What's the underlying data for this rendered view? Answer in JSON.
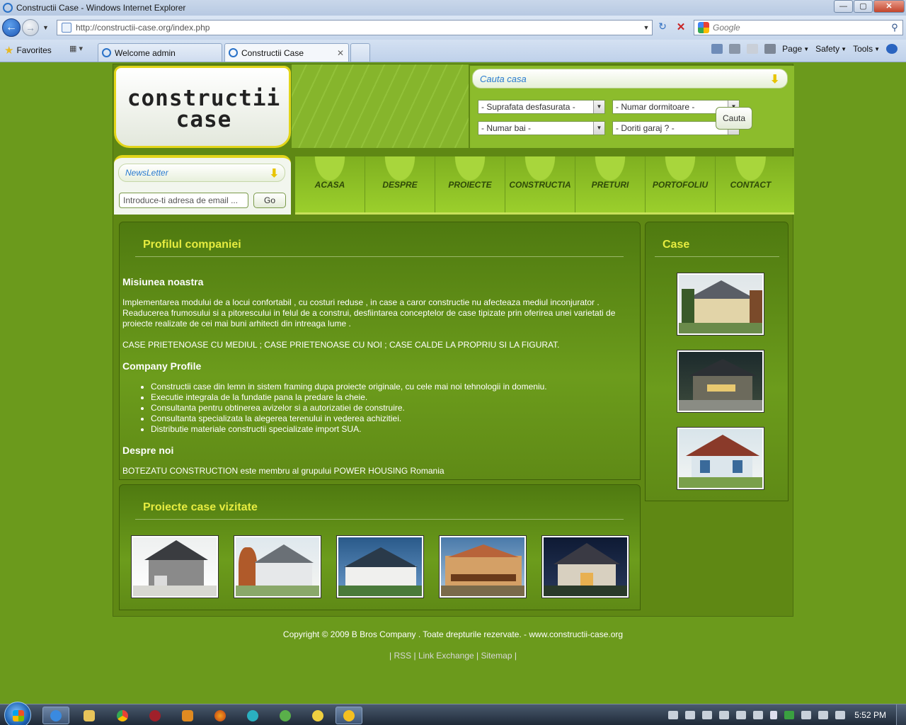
{
  "browser": {
    "window_title": "Constructii Case - Windows Internet Explorer",
    "url": "http://constructii-case.org/index.php",
    "search_placeholder": "Google",
    "favorites_label": "Favorites",
    "tabs": [
      {
        "label": "Welcome admin",
        "active": false
      },
      {
        "label": "Constructii Case",
        "active": true
      }
    ],
    "commands": {
      "page": "Page",
      "safety": "Safety",
      "tools": "Tools"
    },
    "window_buttons": {
      "minimize": "—",
      "maximize": "▢",
      "close": "✕"
    }
  },
  "site": {
    "logo_line1": "constructii",
    "logo_line2": "case",
    "search": {
      "title": "Cauta casa",
      "selects": [
        {
          "value": "- Suprafata desfasurata -"
        },
        {
          "value": "- Numar dormitoare -"
        },
        {
          "value": "- Numar bai -"
        },
        {
          "value": "- Doriti garaj ? -"
        }
      ],
      "button": "Cauta"
    },
    "newsletter": {
      "title": "NewsLetter",
      "placeholder": "Introduce-ti adresa de email ...",
      "button": "Go"
    },
    "nav": [
      "ACASA",
      "DESPRE",
      "PROIECTE",
      "CONSTRUCTIA",
      "PRETURI",
      "PORTOFOLIU",
      "CONTACT"
    ],
    "main": {
      "title": "Profilul companiei",
      "mission_heading": "Misiunea noastra",
      "mission_text": "Implementarea modului de a locui confortabil , cu costuri reduse , in case a caror constructie nu afecteaza mediul inconjurator . Readucerea frumosului si a pitorescului in felul de a construi, desfiintarea conceptelor de case tipizate prin oferirea unei varietati de proiecte realizate de cei mai buni arhitecti din intreaga lume .",
      "slogan": "CASE PRIETENOASE CU MEDIUL ; CASE PRIETENOASE CU NOI ; CASE CALDE LA PROPRIU SI LA FIGURAT.",
      "profile_heading": "Company Profile",
      "profile_items": [
        "Constructii case din lemn in sistem framing dupa proiecte originale, cu cele mai noi tehnologii in domeniu.",
        "Executie integrala de la fundatie pana la predare la cheie.",
        "Consultanta pentru obtinerea avizelor si a autorizatiei de construire.",
        "Consultanta specializata la alegerea terenului in vederea achizitiei.",
        "Distributie materiale constructii specializate import SUA."
      ],
      "about_heading": "Despre noi",
      "about_text": "BOTEZATU CONSTRUCTION este membru al grupului POWER HOUSING Romania"
    },
    "sidebar": {
      "title": "Case"
    },
    "visited": {
      "title": "Proiecte case vizitate"
    },
    "footer": {
      "copyright": "Copyright © 2009 B Bros Company . Toate drepturile rezervate. - www.constructii-case.org",
      "links": [
        "RSS",
        "Link Exchange",
        "Sitemap"
      ]
    }
  },
  "taskbar": {
    "clock": "5:52 PM"
  }
}
